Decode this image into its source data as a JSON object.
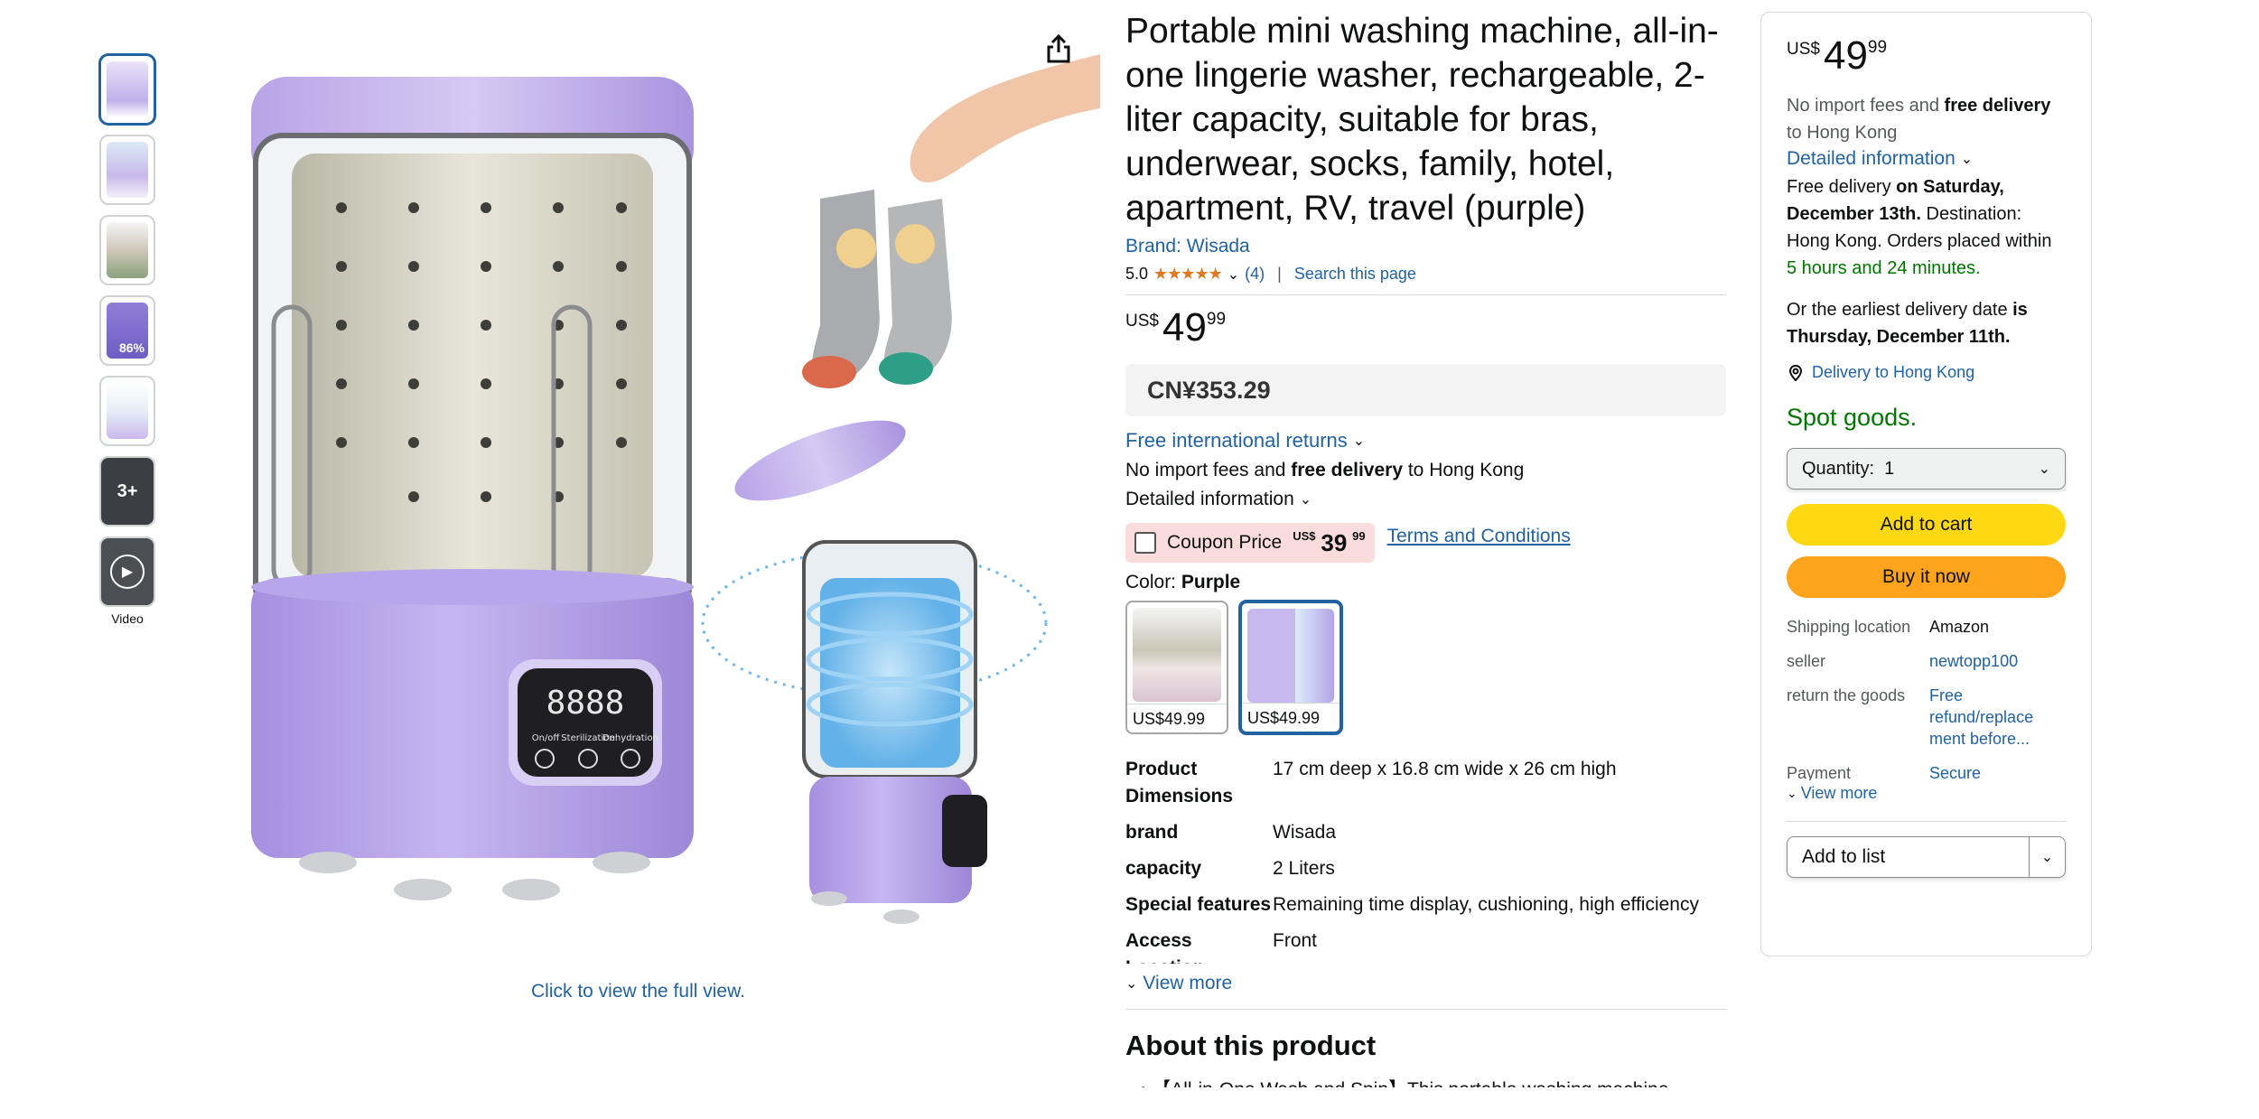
{
  "gallery": {
    "thumb_overlay": "3+",
    "video_label": "Video",
    "view_full": "Click to view the full view.",
    "display_text": "8888",
    "panel_labels": [
      "On/off",
      "Sterilization",
      "Dehydration"
    ],
    "thumb_badge": "86%"
  },
  "product": {
    "title": "Portable mini washing machine, all-in-one lingerie washer, rechargeable, 2-liter capacity, suitable for bras, underwear, socks, family, hotel, apartment, RV, travel (purple)",
    "brand_link": "Brand: Wisada",
    "rating": "5.0",
    "review_count": "(4)",
    "search_page": "Search this page",
    "price_currency": "US$",
    "price_whole": "49",
    "price_fraction": "99",
    "cny_price": "CN¥353.29",
    "returns": "Free international returns",
    "import_prefix": "No import fees and ",
    "import_bold": "free delivery",
    "import_suffix": " to Hong Kong",
    "detailed_info": "Detailed information",
    "coupon_label": "Coupon Price",
    "coupon_currency": "US$",
    "coupon_whole": "39",
    "coupon_fraction": "99",
    "terms": "Terms and Conditions",
    "color_label": "Color: ",
    "color_value": "Purple",
    "swatches": [
      {
        "price": "US$49.99"
      },
      {
        "price": "US$49.99"
      }
    ],
    "specs": [
      {
        "key": "Product Dimensions",
        "value": "17 cm deep x 16.8 cm wide x 26 cm high"
      },
      {
        "key": "brand",
        "value": "Wisada"
      },
      {
        "key": "capacity",
        "value": "2 Liters"
      },
      {
        "key": "Special features",
        "value": "Remaining time display, cushioning, high efficiency"
      },
      {
        "key": "Access Location",
        "value": "Front"
      }
    ],
    "view_more": "View more",
    "about_heading": "About this product",
    "bullet_1": "【All-in-One Wash and Spin】This portable washing machine"
  },
  "buybox": {
    "currency": "US$",
    "whole": "49",
    "fraction": "99",
    "import_prefix": "No import fees and ",
    "import_bold": "free delivery",
    "import_suffix": " to Hong Kong",
    "detailed_info": "Detailed information",
    "delivery_prefix": "Free delivery ",
    "delivery_bold": "on Saturday, December 13th.",
    "delivery_mid": " Destination: Hong Kong. Orders placed within ",
    "delivery_time": "5 hours and 24 minutes.",
    "earliest_prefix": "Or the earliest delivery date ",
    "earliest_bold": "is Thursday, December 11th.",
    "location": "Delivery to Hong Kong",
    "stock": "Spot goods.",
    "quantity_label": "Quantity:",
    "quantity_value": "1",
    "add_to_cart": "Add to cart",
    "buy_now": "Buy it now",
    "shipping": [
      {
        "key": "Shipping location",
        "value": "Amazon"
      },
      {
        "key": "seller",
        "value": "newtopp100"
      },
      {
        "key": "return the goods",
        "value": "Free refund/replace ment before..."
      },
      {
        "key": "Payment",
        "value": "Secure"
      }
    ],
    "view_more": "View more",
    "add_to_list": "Add to list"
  },
  "colors": {
    "link": "#2162a1",
    "green": "#007600",
    "cart_button": "#ffd814",
    "buy_button": "#ffa41c",
    "coupon_bg": "#fbdcdc",
    "star": "#de7921",
    "product_purple": "#b7a2e4"
  },
  "icons": [
    "share-icon",
    "chevron-down-icon",
    "location-pin-icon",
    "play-icon",
    "star-icon"
  ]
}
